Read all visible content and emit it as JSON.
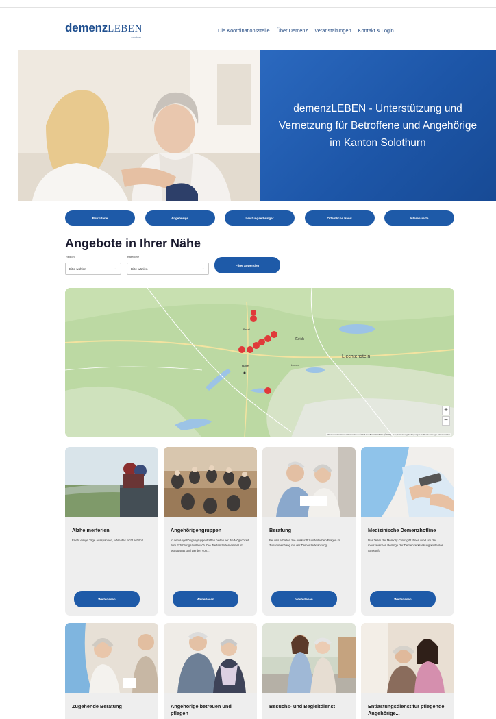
{
  "header": {
    "logo_bold": "demenz",
    "logo_light": "LEBEN",
    "logo_sub": "solothurn",
    "nav": [
      "Die Koordinationsstelle",
      "Über Demenz",
      "Veranstaltungen",
      "Kontakt & Login"
    ]
  },
  "hero": {
    "title": "demenzLEBEN - Unterstützung und Vernetzung für Betroffene und Angehörige im Kanton Solothurn"
  },
  "categories": [
    "Betroffene",
    "Angehörige",
    "Leistungserbringer",
    "Öffentliche Hand",
    "Interessierte"
  ],
  "offers": {
    "title": "Angebote in Ihrer Nähe",
    "region_label": "Region",
    "region_value": "Bitte wählen",
    "category_label": "Kategorie",
    "category_value": "Bitte wählen",
    "filter_button": "Filter anwenden"
  },
  "map": {
    "labels": [
      "Zürich",
      "Bern",
      "Liechtenstein",
      "Basel",
      "Luzern"
    ],
    "zoom_in": "+",
    "zoom_out": "−",
    "attribution": "Tastenkombinationen  Kartendaten ©2024 GeoBasis-DE/BKG (©2009), Google  Nutzungsbedingungen  Fehler bei Google Maps melden"
  },
  "cards_row1": [
    {
      "title": "Alzheimerferien",
      "text": "Erlebt einige Tage ausspannen, wäre das nicht schön?",
      "button": "Weiterlesen"
    },
    {
      "title": "Angehörigengruppen",
      "text": "In den Angehörigengruppentreffen bieten wir die Möglichkeit zum Erfahrungsaustausch. Die Treffen finden einmal im Monat statt und werden von...",
      "button": "Weiterlesen"
    },
    {
      "title": "Beratung",
      "text": "Bei uns erhalten Sie Auskunft zu sämtlichen Fragen im Zusammenhang mit der Demenzerkrankung.",
      "button": "Weiterlesen"
    },
    {
      "title": "Medizinische Demenzhotline",
      "text": "Das Team der Memory Clinic gibt Ihnen rund um die medizinischen Belange der Demenzerkrankung kostenlos Auskunft.",
      "button": "Weiterlesen"
    }
  ],
  "cards_row2": [
    {
      "title": "Zugehende Beratung"
    },
    {
      "title": "Angehörige betreuen und pflegen"
    },
    {
      "title": "Besuchs- und Begleitdienst"
    },
    {
      "title": "Entlastungsdienst für pflegende Angehörige..."
    }
  ],
  "colors": {
    "brand_blue": "#1e5aa8",
    "hero_blue": "#2260b4",
    "card_bg": "#eeeeee"
  }
}
